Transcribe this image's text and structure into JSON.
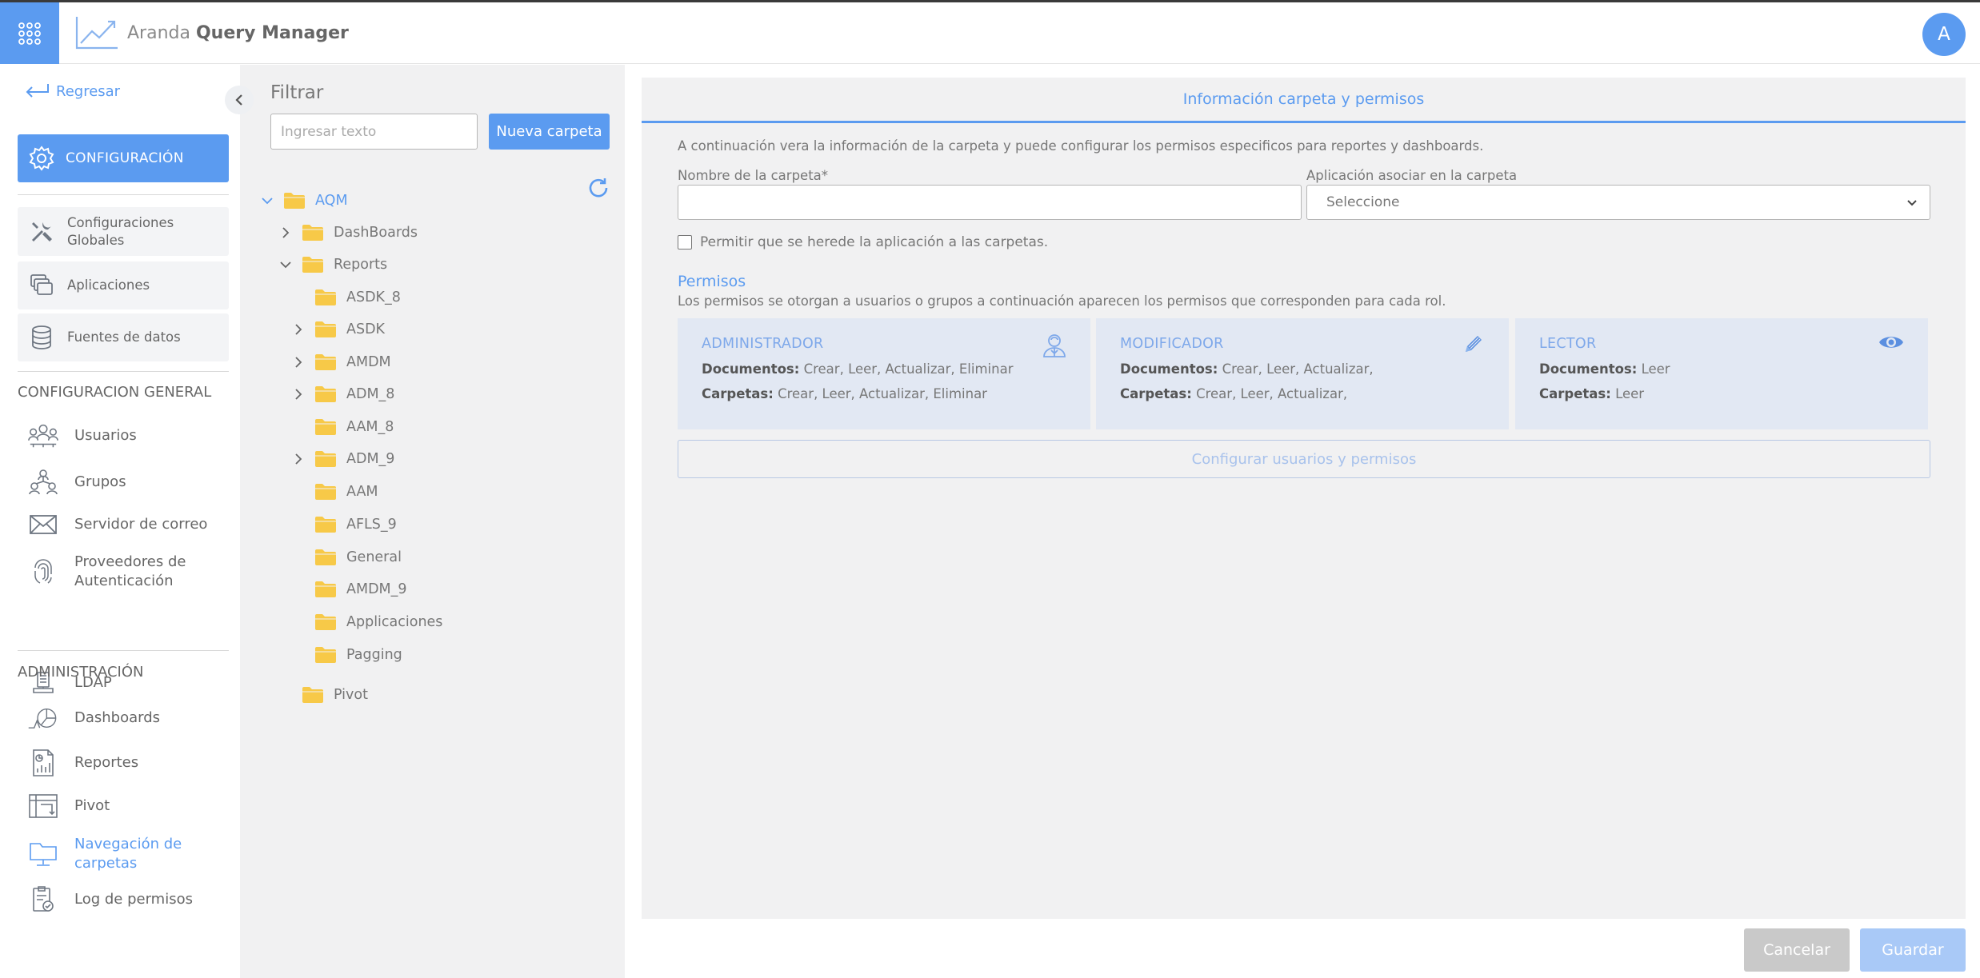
{
  "header": {
    "app_name_light": "Aranda",
    "app_name_bold": "Query Manager",
    "avatar_initial": "A",
    "icons": {
      "apps": "grid-dots-icon",
      "logo": "trend-chart-icon"
    }
  },
  "sidebar": {
    "back_label": "Regresar",
    "config_button": "CONFIGURACIÓN",
    "config_items": [
      {
        "label": "Configuraciones Globales",
        "icon": "tools-icon"
      },
      {
        "label": "Aplicaciones",
        "icon": "apps-stack-icon"
      },
      {
        "label": "Fuentes de datos",
        "icon": "database-icon"
      }
    ],
    "general_section": "CONFIGURACION GENERAL",
    "general_items": [
      {
        "label": "Usuarios",
        "icon": "users-icon"
      },
      {
        "label": "Grupos",
        "icon": "groups-icon"
      },
      {
        "label": "Servidor de correo",
        "icon": "mail-icon"
      },
      {
        "label": "Proveedores de Autenticación",
        "icon": "fingerprint-icon"
      },
      {
        "label": "LDAP",
        "icon": "ldap-icon"
      }
    ],
    "admin_section": "ADMINISTRACIÓN",
    "admin_items": [
      {
        "label": "Dashboards",
        "icon": "dashboard-icon"
      },
      {
        "label": "Reportes",
        "icon": "report-icon"
      },
      {
        "label": "Pivot",
        "icon": "pivot-icon"
      },
      {
        "label": "Navegación de carpetas",
        "icon": "folder-nav-icon",
        "active": true
      },
      {
        "label": "Log de permisos",
        "icon": "log-icon"
      }
    ]
  },
  "tree": {
    "filter_title": "Filtrar",
    "filter_placeholder": "Ingresar texto",
    "new_folder_button": "Nueva carpeta",
    "nodes": [
      {
        "label": "AQM",
        "level": 0,
        "expanded": true
      },
      {
        "label": "DashBoards",
        "level": 1,
        "expandable": true
      },
      {
        "label": "Reports",
        "level": 1,
        "expanded": true
      },
      {
        "label": "ASDK_8",
        "level": 2
      },
      {
        "label": "ASDK",
        "level": 2,
        "expandable": true
      },
      {
        "label": "AMDM",
        "level": 2,
        "expandable": true
      },
      {
        "label": "ADM_8",
        "level": 2,
        "expandable": true
      },
      {
        "label": "AAM_8",
        "level": 2
      },
      {
        "label": "ADM_9",
        "level": 2,
        "expandable": true
      },
      {
        "label": "AAM",
        "level": 2
      },
      {
        "label": "AFLS_9",
        "level": 2
      },
      {
        "label": "General",
        "level": 2
      },
      {
        "label": "AMDM_9",
        "level": 2
      },
      {
        "label": "Applicaciones",
        "level": 2
      },
      {
        "label": "Pagging",
        "level": 2
      },
      {
        "label": "Pivot",
        "level": 1
      }
    ]
  },
  "panel": {
    "tab_label": "Información carpeta y permisos",
    "description": "A continuación vera la información de la carpeta y puede configurar los permisos especificos para reportes y dashboards.",
    "folder_name_label": "Nombre de la carpeta*",
    "folder_name_value": "",
    "app_label": "Aplicación asociar en la carpeta",
    "app_select_value": "Seleccione",
    "inherit_checkbox_label": "Permitir que se herede la aplicación a las carpetas.",
    "permissions_title": "Permisos",
    "permissions_desc": "Los permisos se otorgan a usuarios o grupos a continuación aparecen los permisos que corresponden para cada rol.",
    "roles": [
      {
        "name": "ADMINISTRADOR",
        "icon": "admin-user-icon",
        "docs_label": "Documentos:",
        "docs": "Crear, Leer, Actualizar, Eliminar",
        "folders_label": "Carpetas:",
        "folders": "Crear, Leer, Actualizar, Eliminar"
      },
      {
        "name": "MODIFICADOR",
        "icon": "pencil-icon",
        "docs_label": "Documentos:",
        "docs": "Crear, Leer, Actualizar,",
        "folders_label": "Carpetas:",
        "folders": "Crear, Leer, Actualizar,"
      },
      {
        "name": "LECTOR",
        "icon": "eye-icon",
        "docs_label": "Documentos:",
        "docs": "Leer",
        "folders_label": "Carpetas:",
        "folders": "Leer"
      }
    ],
    "configure_button": "Configurar usuarios y permisos"
  },
  "footer": {
    "cancel": "Cancelar",
    "save": "Guardar"
  },
  "colors": {
    "accent": "#5b9bf0",
    "panel_bg": "#f1f1f2",
    "card_bg": "#e2e8f3",
    "folder": "#f7c948"
  }
}
